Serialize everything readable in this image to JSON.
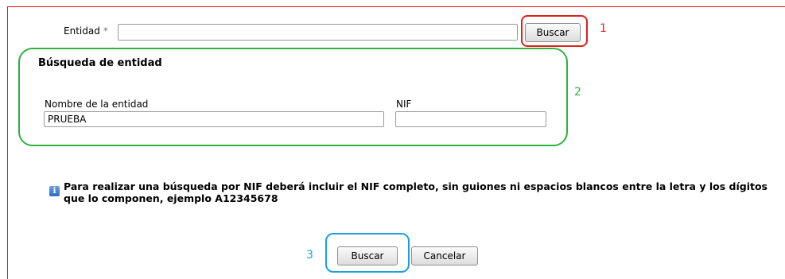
{
  "entity": {
    "label": "Entidad",
    "required_mark": "*",
    "value": "",
    "search_button": "Buscar"
  },
  "search_section": {
    "title": "Búsqueda de entidad",
    "name_label": "Nombre de la entidad",
    "name_value": "PRUEBA",
    "nif_label": "NIF",
    "nif_value": ""
  },
  "info": {
    "icon": "info-icon",
    "text": "Para realizar una búsqueda por NIF deberá incluir el NIF completo, sin guiones ni espacios blancos entre la letra y los dígitos que lo componen, ejemplo A12345678"
  },
  "actions": {
    "search": "Buscar",
    "cancel": "Cancelar"
  },
  "annotations": {
    "one": "1",
    "two": "2",
    "three": "3"
  },
  "colors": {
    "frame": "#e8141a",
    "marker_1": "#e01f1f",
    "marker_2": "#2db23d",
    "marker_3": "#1aa0e0"
  }
}
